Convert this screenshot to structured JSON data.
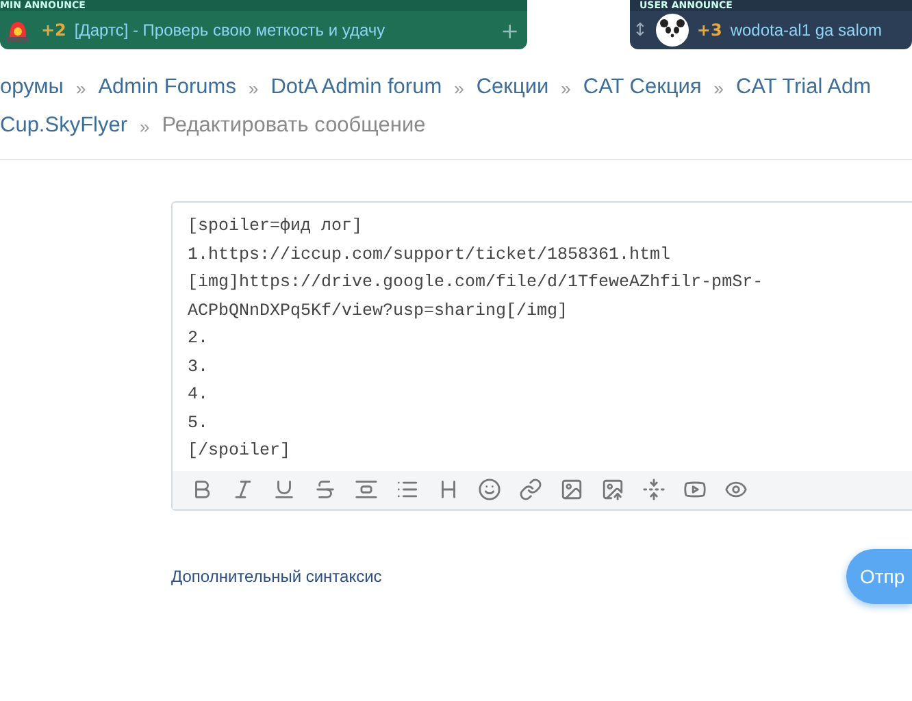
{
  "announcements": [
    {
      "kind": "admin",
      "heading": "MIN ANNOUNCE",
      "count": "+2",
      "text": "[Дартс] - Проверь свою меткость и удачу",
      "action": "+"
    },
    {
      "kind": "user",
      "heading": "USER ANNOUNCE",
      "handle": "↕",
      "count": "+3",
      "text": "wodota-al1 ga salom"
    }
  ],
  "breadcrumb_rows": [
    [
      {
        "label": "орумы",
        "current": false
      },
      {
        "separator": "»",
        "label": "Admin Forums",
        "current": false
      },
      {
        "separator": "»",
        "label": "DotA Admin forum",
        "current": false
      },
      {
        "separator": "»",
        "label": "Секции",
        "current": false
      },
      {
        "separator": "»",
        "label": "CAT Секция",
        "current": false
      },
      {
        "separator": "»",
        "label": "CAT Trial Adm",
        "current": false
      }
    ],
    [
      {
        "label": "Cup.SkyFlyer",
        "current": false
      },
      {
        "separator": "»",
        "label": "Редактировать сообщение",
        "current": true
      }
    ]
  ],
  "editor": {
    "lines": [
      "[spoiler=фид лог]",
      "1.https://iccup.com/support/ticket/1858361.html",
      "[img]https://drive.google.com/file/d/1TfeweAZhfilr-pmSr-",
      "ACPbQNnDXPq5Kf/view?usp=sharing[/img]",
      "2.",
      "3.",
      "4.",
      "5.",
      "[/spoiler]"
    ]
  },
  "syntax_link": "Дополнительный синтаксис",
  "submit_button": "Отпр"
}
